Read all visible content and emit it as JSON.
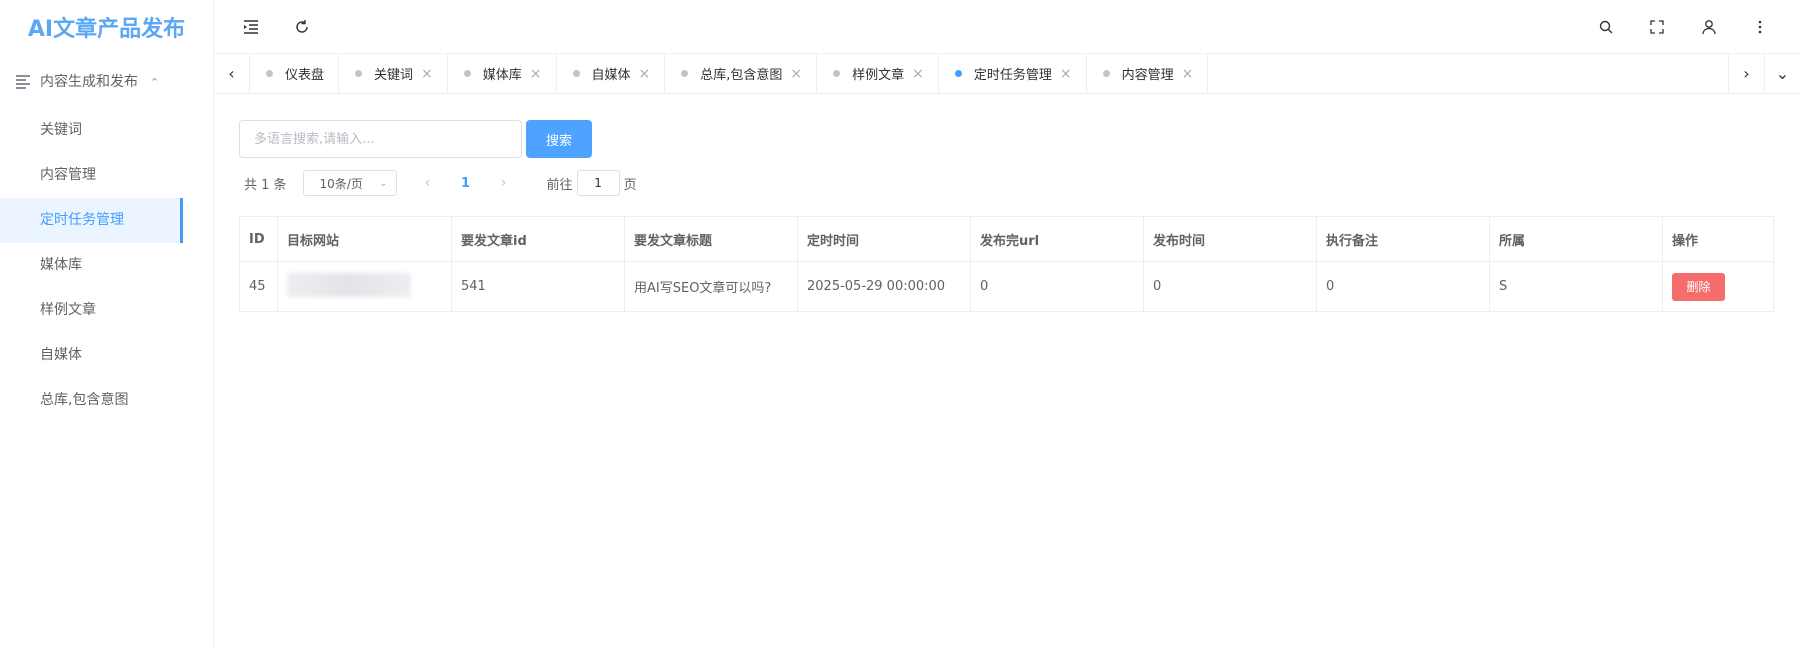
{
  "app": {
    "title": "AI文章产品发布"
  },
  "sidebar": {
    "group_label": "内容生成和发布",
    "items": [
      {
        "label": "关键词"
      },
      {
        "label": "内容管理"
      },
      {
        "label": "定时任务管理"
      },
      {
        "label": "媒体库"
      },
      {
        "label": "样例文章"
      },
      {
        "label": "自媒体"
      },
      {
        "label": "总库,包含意图"
      }
    ],
    "active_index": 2
  },
  "tabs": [
    {
      "label": "仪表盘",
      "closable": false,
      "active": false
    },
    {
      "label": "关键词",
      "closable": true,
      "active": false
    },
    {
      "label": "媒体库",
      "closable": true,
      "active": false
    },
    {
      "label": "自媒体",
      "closable": true,
      "active": false
    },
    {
      "label": "总库,包含意图",
      "closable": true,
      "active": false
    },
    {
      "label": "样例文章",
      "closable": true,
      "active": false
    },
    {
      "label": "定时任务管理",
      "closable": true,
      "active": true
    },
    {
      "label": "内容管理",
      "closable": true,
      "active": false
    }
  ],
  "search": {
    "placeholder": "多语言搜索,请输入...",
    "value": "",
    "button_label": "搜索"
  },
  "pagination": {
    "total_label": "共 1 条",
    "page_size_label": "10条/页",
    "current_page": "1",
    "goto_label": "前往",
    "goto_value": "1",
    "goto_unit": "页"
  },
  "table": {
    "columns": [
      "ID",
      "目标网站",
      "要发文章id",
      "要发文章标题",
      "定时时间",
      "发布完url",
      "发布时间",
      "执行备注",
      "所属",
      "操作"
    ],
    "rows": [
      {
        "id": "45",
        "article_id": "541",
        "title": "用AI写SEO文章可以吗?",
        "scheduled_time": "2025-05-29 00:00:00",
        "published_url": "0",
        "published_time": "0",
        "note": "0",
        "owner": "S",
        "action_label": "删除"
      }
    ]
  },
  "colors": {
    "primary": "#409eff",
    "danger": "#f56c6c",
    "logo": "#5aa8f5"
  }
}
